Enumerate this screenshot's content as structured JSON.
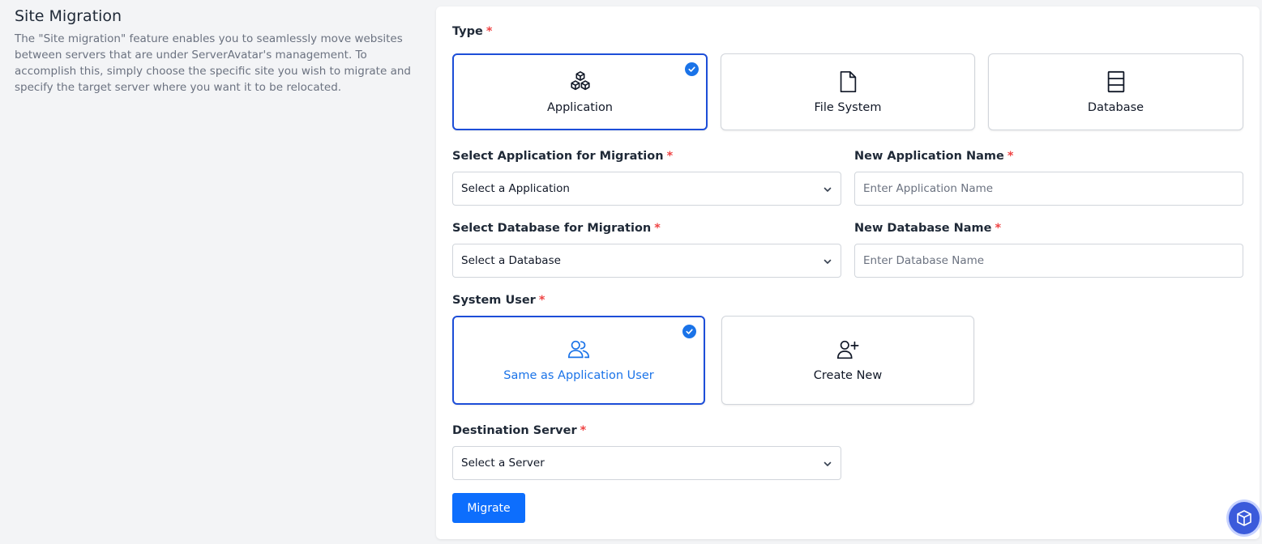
{
  "intro": {
    "title": "Site Migration",
    "description": "The \"Site migration\" feature enables you to seamlessly move websites between servers that are under ServerAvatar's management. To accomplish this, simply choose the specific site you wish to migrate and specify the target server where you want it to be relocated."
  },
  "form": {
    "required_mark": "*",
    "type": {
      "label": "Type",
      "options": [
        {
          "label": "Application",
          "icon": "cubes-icon",
          "selected": true
        },
        {
          "label": "File System",
          "icon": "file-icon",
          "selected": false
        },
        {
          "label": "Database",
          "icon": "database-icon",
          "selected": false
        }
      ]
    },
    "select_application": {
      "label": "Select Application for Migration",
      "value": "Select a Application"
    },
    "new_application_name": {
      "label": "New Application Name",
      "placeholder": "Enter Application Name",
      "value": ""
    },
    "select_database": {
      "label": "Select Database for Migration",
      "value": "Select a Database"
    },
    "new_database_name": {
      "label": "New Database Name",
      "placeholder": "Enter Database Name",
      "value": ""
    },
    "system_user": {
      "label": "System User",
      "options": [
        {
          "label": "Same as Application User",
          "icon": "users-icon",
          "selected": true
        },
        {
          "label": "Create New",
          "icon": "user-plus-icon",
          "selected": false
        }
      ]
    },
    "destination_server": {
      "label": "Destination Server",
      "value": "Select a Server"
    },
    "migrate_label": "Migrate"
  },
  "colors": {
    "accent": "#1a73e8",
    "selected_border": "#1d4ed8",
    "button": "#0d6efd",
    "required": "#ef4444"
  }
}
